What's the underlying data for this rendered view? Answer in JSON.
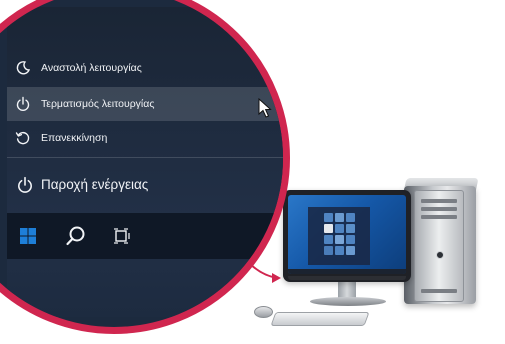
{
  "menu": {
    "items": [
      {
        "label": "Αναστολή λειτουργίας",
        "icon": "moon-icon"
      },
      {
        "label": "Τερματισμός λειτουργίας",
        "icon": "power-icon"
      },
      {
        "label": "Επανεκκίνηση",
        "icon": "restart-icon"
      }
    ],
    "power_label": "Παροχή ενέργειας"
  },
  "taskbar": {
    "icons": [
      "windows-start-icon",
      "search-icon",
      "task-view-icon"
    ]
  },
  "colors": {
    "accent_ring": "#d0264f",
    "menu_bg": "#1a2535",
    "taskbar_bg": "#0f1826",
    "windows_blue": "#1e7fd8"
  }
}
